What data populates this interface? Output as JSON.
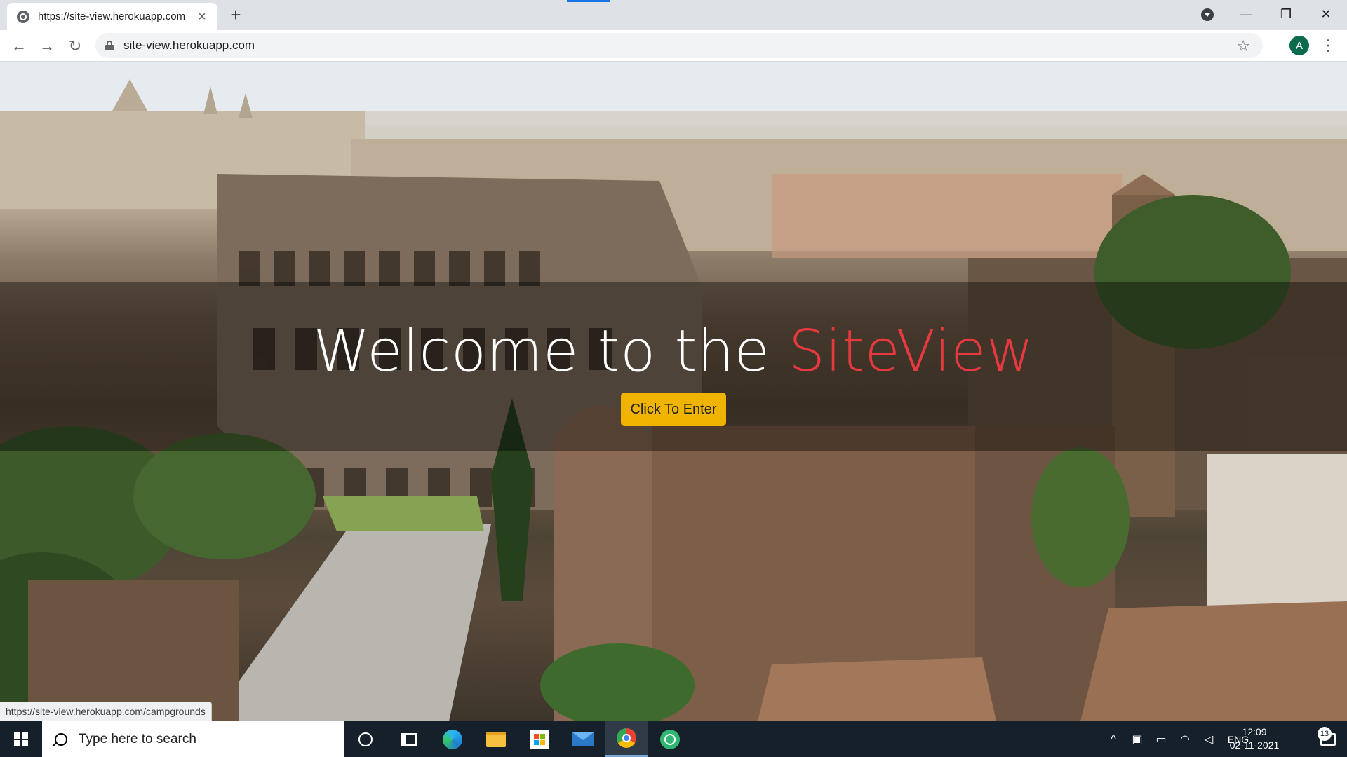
{
  "browser": {
    "tab_title": "https://site-view.herokuapp.com",
    "tab_close": "×",
    "new_tab": "+",
    "url": "site-view.herokuapp.com",
    "profile_initial": "A",
    "window_controls": {
      "minimize": "—",
      "restore": "❐",
      "close": "✕"
    },
    "nav": {
      "back": "←",
      "forward": "→",
      "reload": "↻",
      "bookmark": "☆",
      "menu": "⋮"
    }
  },
  "page": {
    "title_prefix": "Welcome to the ",
    "title_brand": "SiteView",
    "enter_button": "Click To Enter",
    "status_link": "https://site-view.herokuapp.com/campgrounds",
    "colors": {
      "brand_accent": "#e8393f",
      "button": "#f0b400"
    }
  },
  "taskbar": {
    "search_placeholder": "Type here to search",
    "tray": {
      "chevron": "^",
      "language": "ENG"
    },
    "clock": {
      "time": "12:09",
      "date": "02-11-2021"
    },
    "notifications_count": "13",
    "pinned": [
      "cortana-icon",
      "task-view-icon",
      "edge-icon",
      "file-explorer-icon",
      "store-icon",
      "mail-icon",
      "chrome-icon",
      "atom-icon"
    ]
  }
}
